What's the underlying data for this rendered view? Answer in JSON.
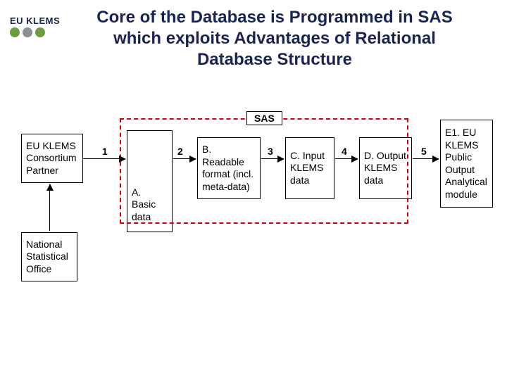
{
  "logo": {
    "text": "EU KLEMS",
    "dot_colors": [
      "#6e9b3f",
      "#8a8f94",
      "#6e9b3f"
    ]
  },
  "title": "Core of the Database is Programmed in SAS which exploits Advantages of Relational Database Structure",
  "diagram": {
    "sas_label": "SAS",
    "boxes": {
      "eu_partner": "EU KLEMS Consortium Partner",
      "nso": "National Statistical Office",
      "a": "A. Basic data",
      "b": "B. Readable format (incl. meta-data)",
      "c": "C. Input KLEMS data",
      "d": "D. Output KLEMS data",
      "e": "E1. EU KLEMS Public Output Analytical module"
    },
    "arrow_labels": [
      "1",
      "2",
      "3",
      "4",
      "5"
    ]
  }
}
